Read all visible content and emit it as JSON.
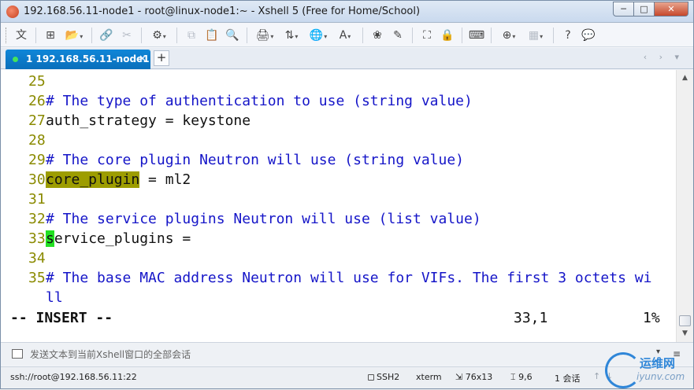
{
  "window": {
    "title": "192.168.56.11-node1 - root@linux-node1:~ - Xshell 5 (Free for Home/School)",
    "buttons": {
      "minimize": "─",
      "maximize": "□",
      "close": "✕"
    }
  },
  "toolbar": {
    "items": [
      {
        "name": "language-icon",
        "glyph": "文"
      },
      {
        "name": "new-session-icon",
        "glyph": "⊞"
      },
      {
        "name": "open-folder-icon",
        "glyph": "📂"
      },
      {
        "name": "reconnect-icon",
        "glyph": "🔗"
      },
      {
        "name": "disconnect-icon",
        "glyph": "✂"
      },
      {
        "name": "properties-icon",
        "glyph": "⚙"
      },
      {
        "name": "copy-icon",
        "glyph": "⧉"
      },
      {
        "name": "paste-icon",
        "glyph": "📋"
      },
      {
        "name": "find-icon",
        "glyph": "🔍"
      },
      {
        "name": "print-icon",
        "glyph": "🖨"
      },
      {
        "name": "transfer-icon",
        "glyph": "⇅"
      },
      {
        "name": "globe-icon",
        "glyph": "🌐"
      },
      {
        "name": "font-icon",
        "glyph": "A"
      },
      {
        "name": "xftp-icon",
        "glyph": "❀"
      },
      {
        "name": "script-icon",
        "glyph": "✎"
      },
      {
        "name": "fullscreen-icon",
        "glyph": "⛶"
      },
      {
        "name": "lock-icon",
        "glyph": "🔒"
      },
      {
        "name": "keyboard-icon",
        "glyph": "⌨"
      },
      {
        "name": "add-icon",
        "glyph": "⊕"
      },
      {
        "name": "layout-icon",
        "glyph": "▦"
      },
      {
        "name": "help-icon",
        "glyph": "?"
      },
      {
        "name": "chat-icon",
        "glyph": "💬"
      }
    ]
  },
  "tabs": [
    {
      "label": "1 192.168.56.11-node1",
      "close": "×"
    }
  ],
  "tab_add": "+",
  "tab_nav": "‹ › ▾",
  "terminal": {
    "lines": [
      {
        "num": "25",
        "text": "",
        "type": "txt"
      },
      {
        "num": "26",
        "text": "# The type of authentication to use (string value)",
        "type": "cmt"
      },
      {
        "num": "27",
        "text": "auth_strategy = keystone",
        "type": "txt"
      },
      {
        "num": "28",
        "text": "",
        "type": "txt"
      },
      {
        "num": "29",
        "text": "# The core plugin Neutron will use (string value)",
        "type": "cmt"
      },
      {
        "num": "30",
        "hl": "core_plugin",
        "text": " = ml2",
        "type": "txt"
      },
      {
        "num": "31",
        "text": "",
        "type": "txt"
      },
      {
        "num": "32",
        "text": "# The service plugins Neutron will use (list value)",
        "type": "cmt"
      },
      {
        "num": "33",
        "cursor": "s",
        "text": "ervice_plugins =",
        "type": "txt"
      },
      {
        "num": "34",
        "text": "",
        "type": "txt"
      },
      {
        "num": "35",
        "text": "# The base MAC address Neutron will use for VIFs. The first 3 octets wi",
        "type": "cmt"
      }
    ],
    "wrap_text": "ll",
    "mode": "-- INSERT --",
    "position": "33,1",
    "percent": "1%"
  },
  "sendbar": {
    "placeholder": "发送文本到当前Xshell窗口的全部会话",
    "dropdown": "▾",
    "menu": "≡"
  },
  "statusbar": {
    "connection": "ssh://root@192.168.56.11:22",
    "protocol": "SSH2",
    "terminal_type": "xterm",
    "size": "76x13",
    "cursor": "9,6",
    "sessions": "1 会话",
    "up": "↑",
    "down": "↓"
  },
  "watermark": {
    "line1": "运维网",
    "line2": "iyunv.com"
  }
}
